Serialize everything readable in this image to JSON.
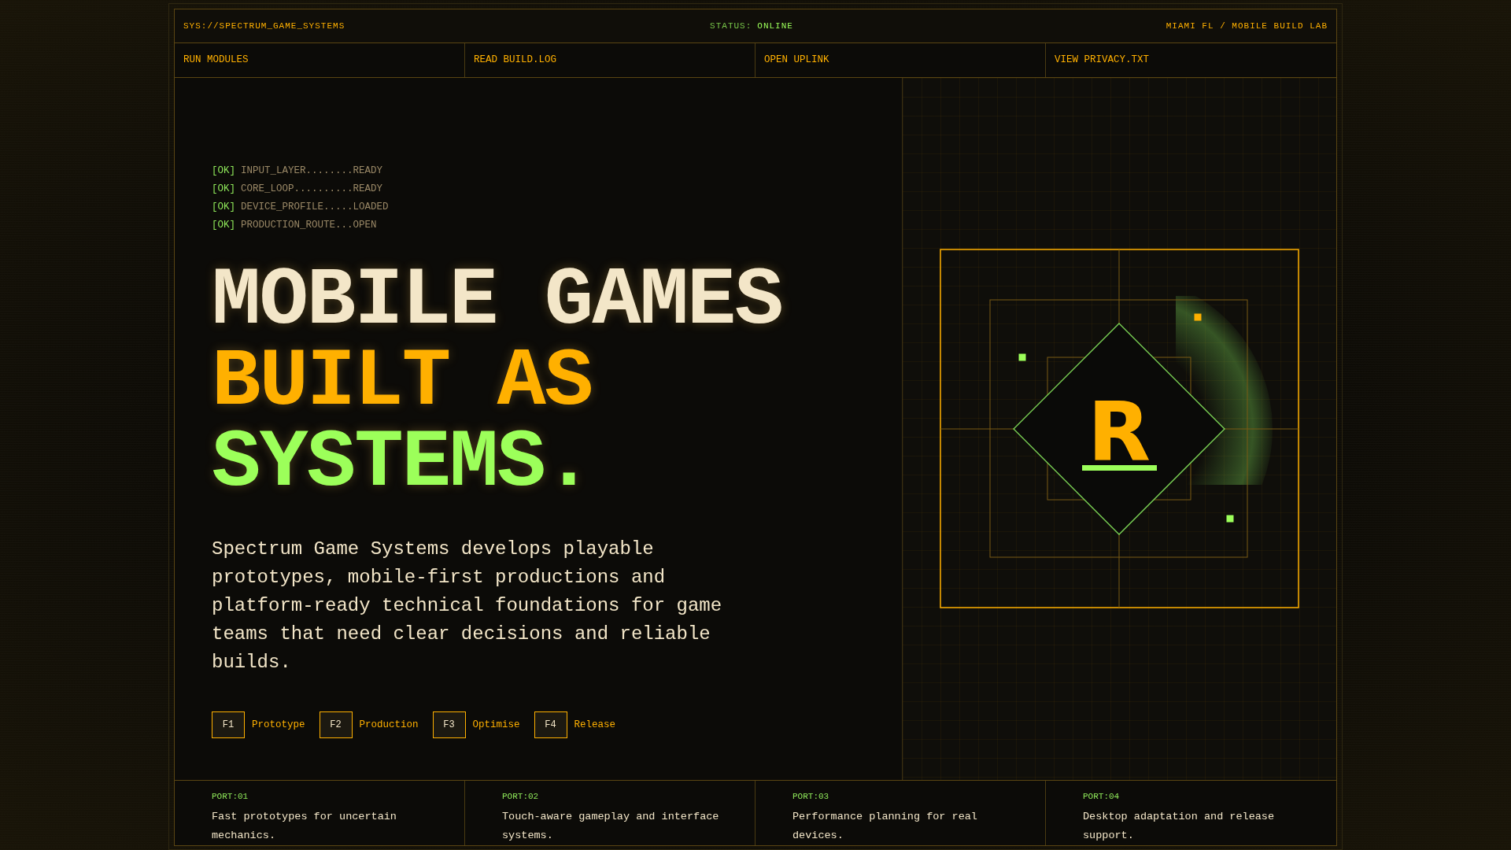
{
  "header": {
    "system_id": "SYS://SPECTRUM_GAME_SYSTEMS",
    "status": {
      "label": "STATUS:",
      "value": "ONLINE"
    },
    "location": "MIAMI FL / MOBILE BUILD LAB"
  },
  "nav": [
    "RUN MODULES",
    "READ BUILD.LOG",
    "OPEN UPLINK",
    "VIEW PRIVACY.TXT"
  ],
  "boot_log": [
    {
      "status": "[OK]",
      "text": "INPUT_LAYER........READY"
    },
    {
      "status": "[OK]",
      "text": "CORE_LOOP..........READY"
    },
    {
      "status": "[OK]",
      "text": "DEVICE_PROFILE.....LOADED"
    },
    {
      "status": "[OK]",
      "text": "PRODUCTION_ROUTE...OPEN"
    }
  ],
  "headline": [
    {
      "text": "MOBILE GAMES",
      "color": "#f3e6c8"
    },
    {
      "text": "BUILT AS",
      "color": "#ffb000"
    },
    {
      "text": "SYSTEMS.",
      "color": "#9cff5a"
    }
  ],
  "description": "Spectrum Game Systems develops playable prototypes, mobile-first productions and platform-ready technical foundations for game teams that need clear decisions and reliable builds.",
  "steps": [
    {
      "key": "F1",
      "label": "Prototype"
    },
    {
      "key": "F2",
      "label": "Production"
    },
    {
      "key": "F3",
      "label": "Optimise"
    },
    {
      "key": "F4",
      "label": "Release"
    }
  ],
  "logo": {
    "letter": "R"
  },
  "ports": [
    {
      "label": "PORT:01",
      "text": "Fast prototypes for uncertain mechanics."
    },
    {
      "label": "PORT:02",
      "text": "Touch-aware gameplay and interface systems."
    },
    {
      "label": "PORT:03",
      "text": "Performance planning for real devices."
    },
    {
      "label": "PORT:04",
      "text": "Desktop adaptation and release support."
    }
  ]
}
